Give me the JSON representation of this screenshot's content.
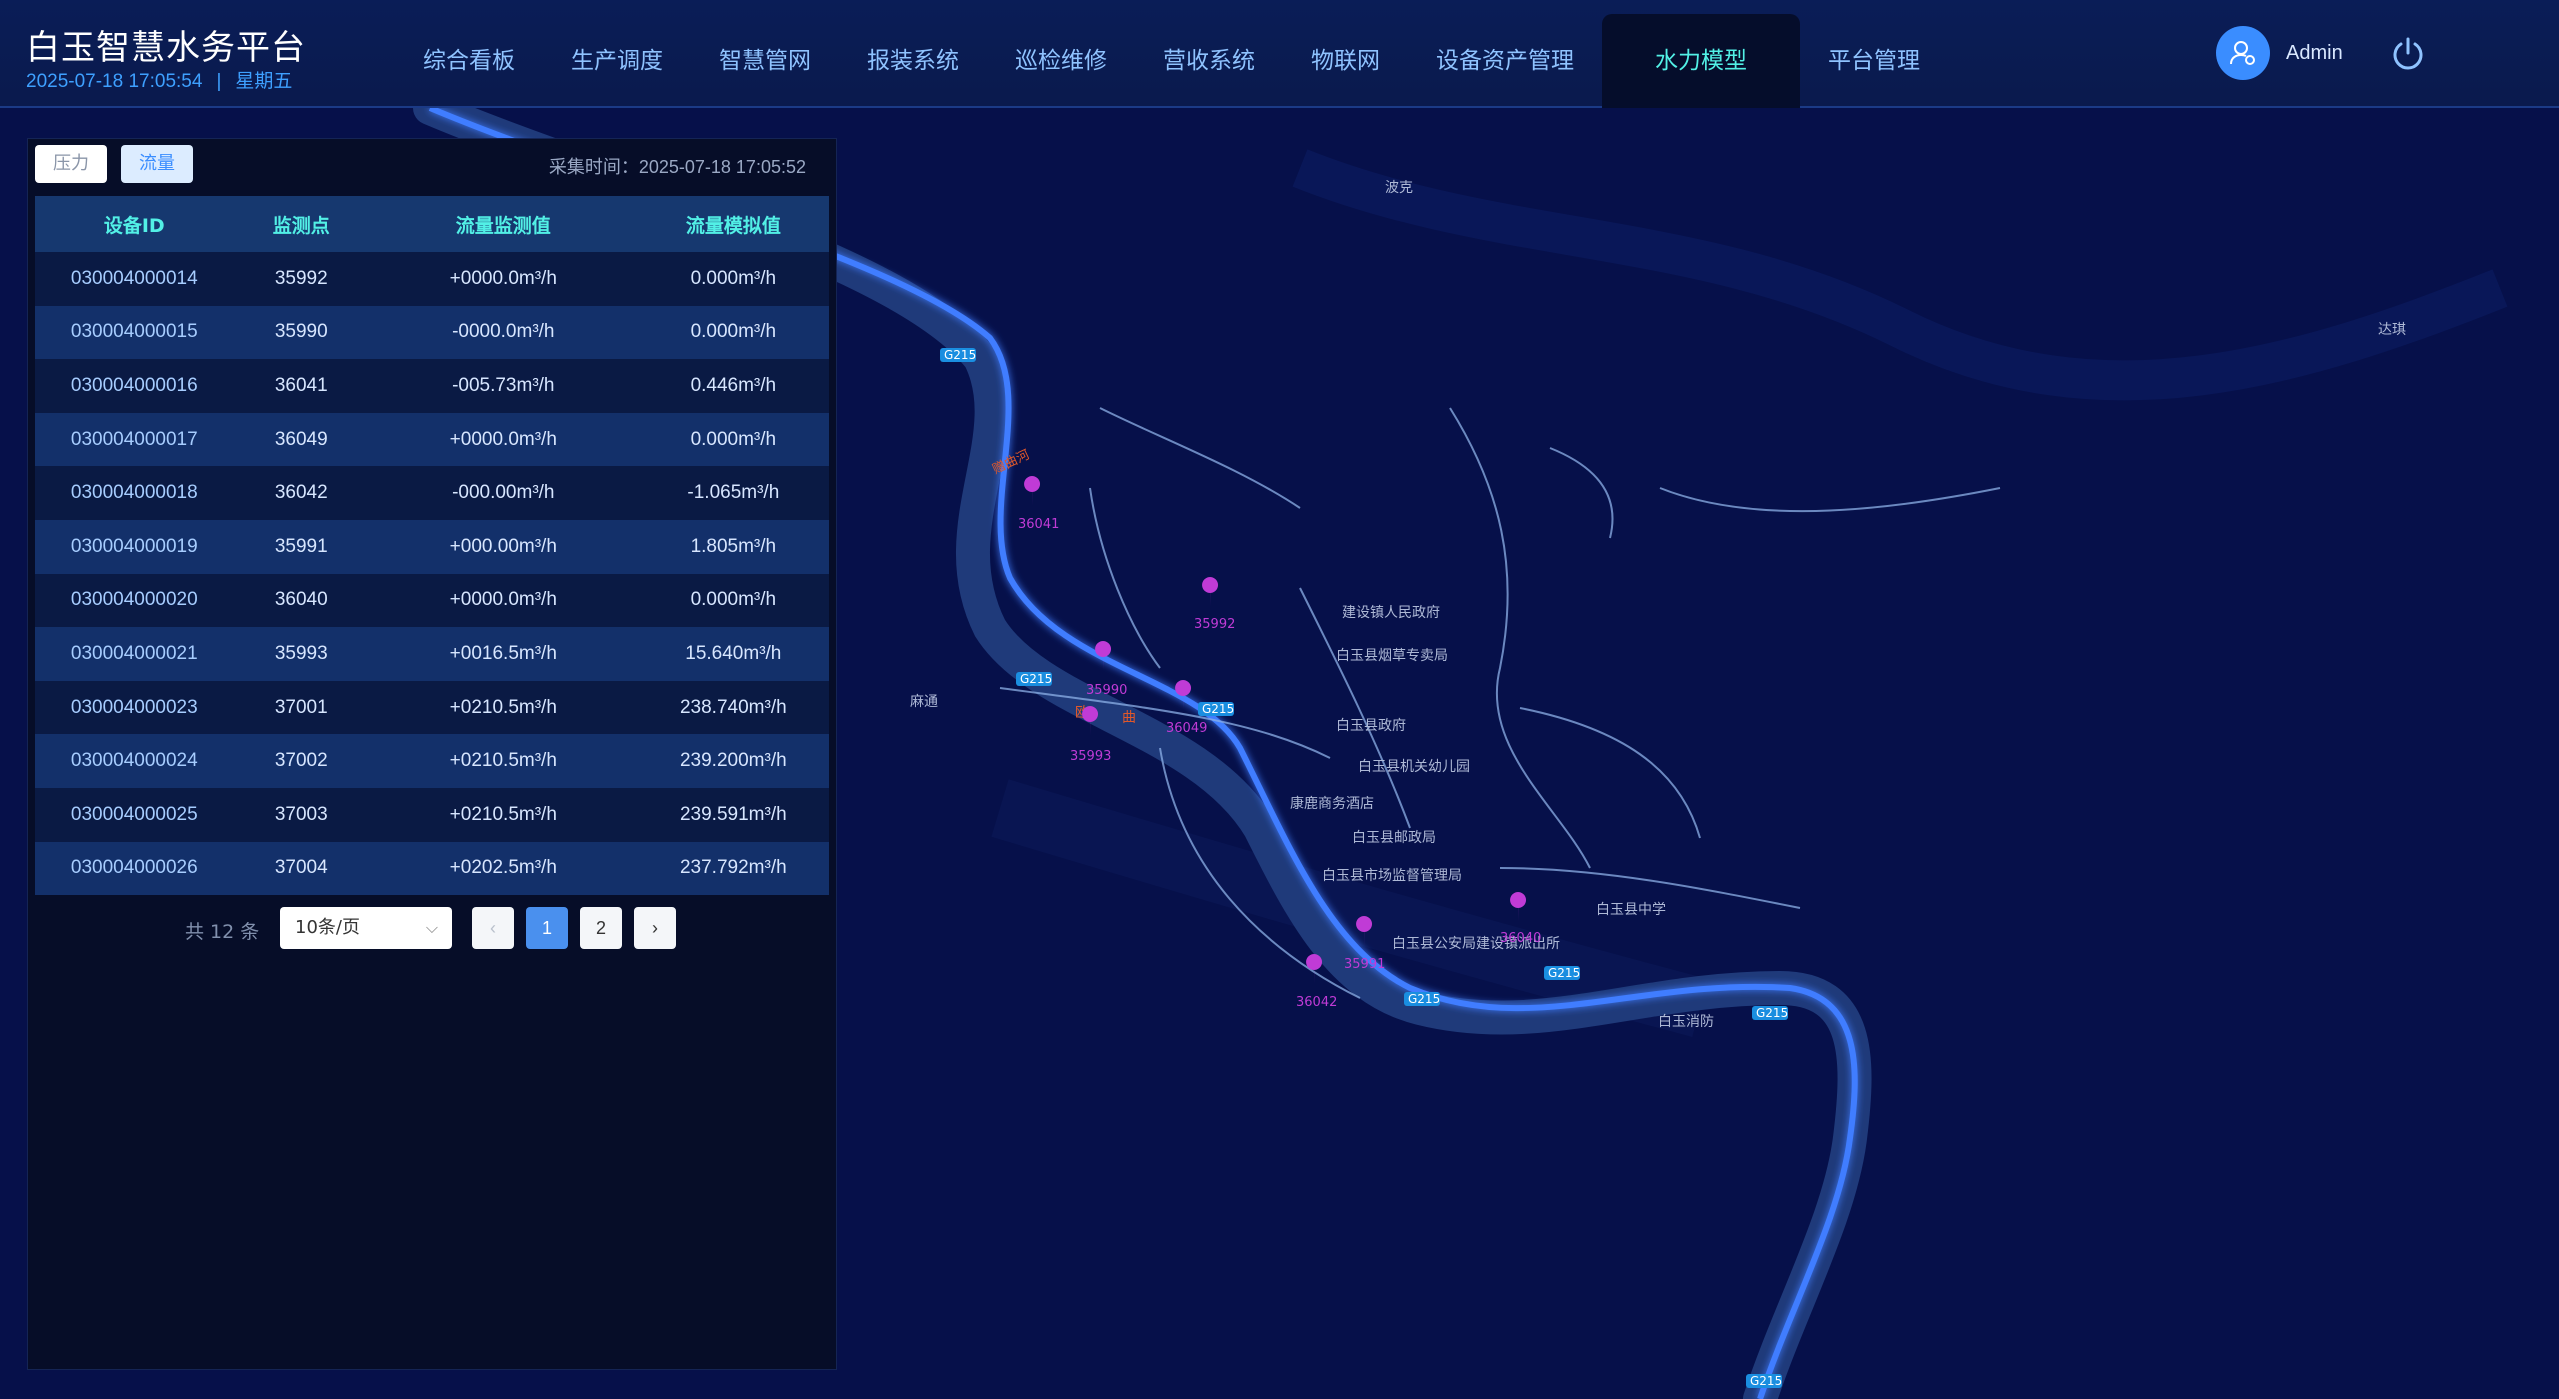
{
  "header": {
    "title": "白玉智慧水务平台",
    "datetime": "2025-07-18 17:05:54",
    "weekday": "星期五",
    "nav": [
      {
        "label": "综合看板"
      },
      {
        "label": "生产调度"
      },
      {
        "label": "智慧管网"
      },
      {
        "label": "报装系统"
      },
      {
        "label": "巡检维修"
      },
      {
        "label": "营收系统"
      },
      {
        "label": "物联网"
      },
      {
        "label": "设备资产管理"
      },
      {
        "label": "水力模型",
        "active": true
      },
      {
        "label": "平台管理"
      }
    ],
    "user": "Admin",
    "icons": {
      "avatar": "user-settings-icon",
      "power": "power-icon"
    },
    "accent": "#52f0e6"
  },
  "panel": {
    "tabs": [
      {
        "label": "压力"
      },
      {
        "label": "流量",
        "active": true
      }
    ],
    "collect_time": "采集时间：2025-07-18 17:05:52",
    "columns": [
      "设备ID",
      "监测点",
      "流量监测值",
      "流量模拟值"
    ],
    "rows": [
      [
        "030004000014",
        "35992",
        "+0000.0m³/h",
        "0.000m³/h"
      ],
      [
        "030004000015",
        "35990",
        "-0000.0m³/h",
        "0.000m³/h"
      ],
      [
        "030004000016",
        "36041",
        "-005.73m³/h",
        "0.446m³/h"
      ],
      [
        "030004000017",
        "36049",
        "+0000.0m³/h",
        "0.000m³/h"
      ],
      [
        "030004000018",
        "36042",
        "-000.00m³/h",
        "-1.065m³/h"
      ],
      [
        "030004000019",
        "35991",
        "+000.00m³/h",
        "1.805m³/h"
      ],
      [
        "030004000020",
        "36040",
        "+0000.0m³/h",
        "0.000m³/h"
      ],
      [
        "030004000021",
        "35993",
        "+0016.5m³/h",
        "15.640m³/h"
      ],
      [
        "030004000023",
        "37001",
        "+0210.5m³/h",
        "238.740m³/h"
      ],
      [
        "030004000024",
        "37002",
        "+0210.5m³/h",
        "239.200m³/h"
      ],
      [
        "030004000025",
        "37003",
        "+0210.5m³/h",
        "239.591m³/h"
      ],
      [
        "030004000026",
        "37004",
        "+0202.5m³/h",
        "237.792m³/h"
      ]
    ],
    "pagination": {
      "total_text": "共 12 条",
      "page_size": "10条/页",
      "prev": "‹",
      "next": "›",
      "pages": [
        "1",
        "2"
      ],
      "current": "1"
    }
  },
  "map": {
    "places": [
      {
        "name": "波克"
      },
      {
        "name": "达琪"
      },
      {
        "name": "麻通"
      },
      {
        "name": "建设镇人民政府"
      },
      {
        "name": "白玉县烟草专卖局"
      },
      {
        "name": "白玉县政府"
      },
      {
        "name": "白玉县机关幼儿园"
      },
      {
        "name": "康鹿商务酒店"
      },
      {
        "name": "白玉县邮政局"
      },
      {
        "name": "白玉县市场监督管理局"
      },
      {
        "name": "白玉县中学"
      },
      {
        "name": "白玉县公安局建设镇派出所"
      },
      {
        "name": "白玉消防"
      }
    ],
    "road_label": "G215",
    "river_labels": [
      "欧",
      "曲"
    ],
    "river_label_north": "赠曲河",
    "markers": [
      "36041",
      "35992",
      "35990",
      "36049",
      "35993",
      "36040",
      "35991",
      "36042"
    ],
    "colors": {
      "background": "#06104a",
      "river": "#1f3a7a",
      "road": "#3f7dff",
      "marker": "#c03bd6"
    }
  }
}
